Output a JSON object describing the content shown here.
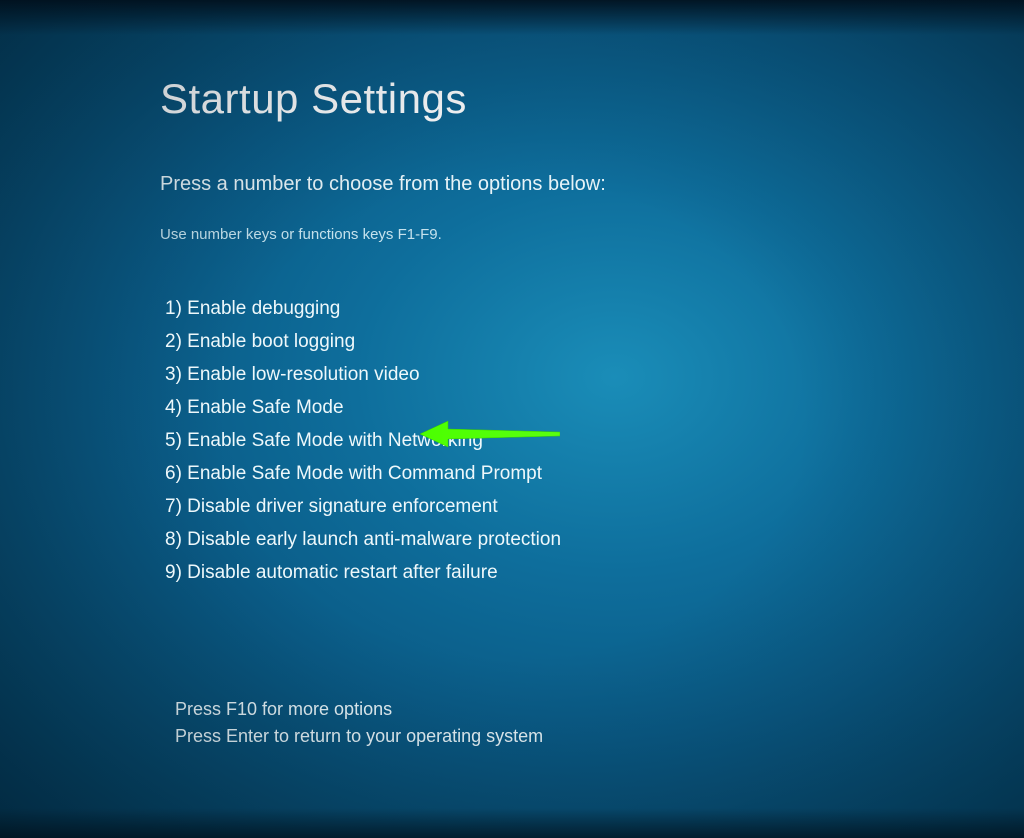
{
  "title": "Startup Settings",
  "subtitle": "Press a number to choose from the options below:",
  "hint": "Use number keys or functions keys F1-F9.",
  "options": [
    "1) Enable debugging",
    "2) Enable boot logging",
    "3) Enable low-resolution video",
    "4) Enable Safe Mode",
    "5) Enable Safe Mode with Networking",
    "6) Enable Safe Mode with Command Prompt",
    "7) Disable driver signature enforcement",
    "8) Disable early launch anti-malware protection",
    "9) Disable automatic restart after failure"
  ],
  "footer": {
    "line1": "Press F10 for more options",
    "line2": "Press Enter to return to your operating system"
  },
  "annotation": {
    "arrow_target_index": 4,
    "arrow_color": "#4bff00"
  }
}
